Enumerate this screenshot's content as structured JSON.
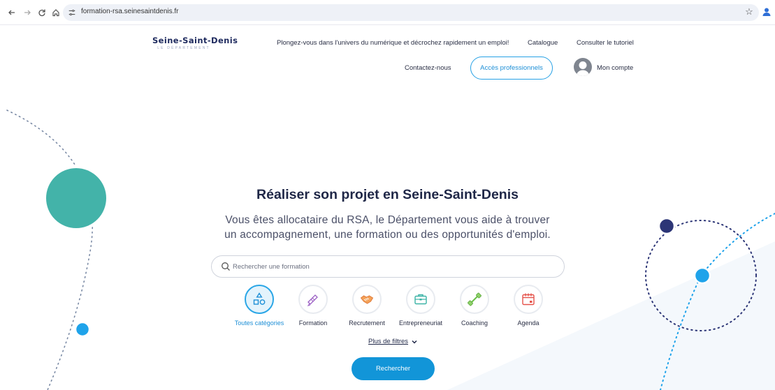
{
  "browser": {
    "url": "formation-rsa.seinesaintdenis.fr"
  },
  "header": {
    "logo_main": "Seine-Saint-Denis",
    "logo_sub": "LE DÉPARTEMENT",
    "tagline": "Plongez-vous dans l'univers du numérique et décrochez rapidement un emploi!",
    "catalogue": "Catalogue",
    "tutorial": "Consulter le tutoriel",
    "contact": "Contactez-nous",
    "pro_access": "Accès professionnels",
    "account": "Mon compte"
  },
  "hero": {
    "title": "Réaliser son projet en Seine-Saint-Denis",
    "subtitle_line1": "Vous êtes allocataire du RSA, le Département vous aide à trouver",
    "subtitle_line2": "un accompagnement, une formation ou des opportunités d'emploi."
  },
  "search": {
    "placeholder": "Rechercher une formation"
  },
  "categories": [
    {
      "label": "Toutes catégories",
      "icon": "shapes-icon",
      "selected": true
    },
    {
      "label": "Formation",
      "icon": "diploma-icon",
      "selected": false
    },
    {
      "label": "Recrutement",
      "icon": "handshake-icon",
      "selected": false
    },
    {
      "label": "Entrepreneuriat",
      "icon": "briefcase-icon",
      "selected": false
    },
    {
      "label": "Coaching",
      "icon": "dumbbell-icon",
      "selected": false
    },
    {
      "label": "Agenda",
      "icon": "calendar-icon",
      "selected": false
    }
  ],
  "filters": {
    "more_label": "Plus de filtres"
  },
  "submit": {
    "label": "Rechercher"
  },
  "colors": {
    "accent_blue": "#1295d8",
    "teal": "#43b3a9",
    "navy": "#2c3576",
    "light_blue_dot": "#1fa3ea"
  }
}
